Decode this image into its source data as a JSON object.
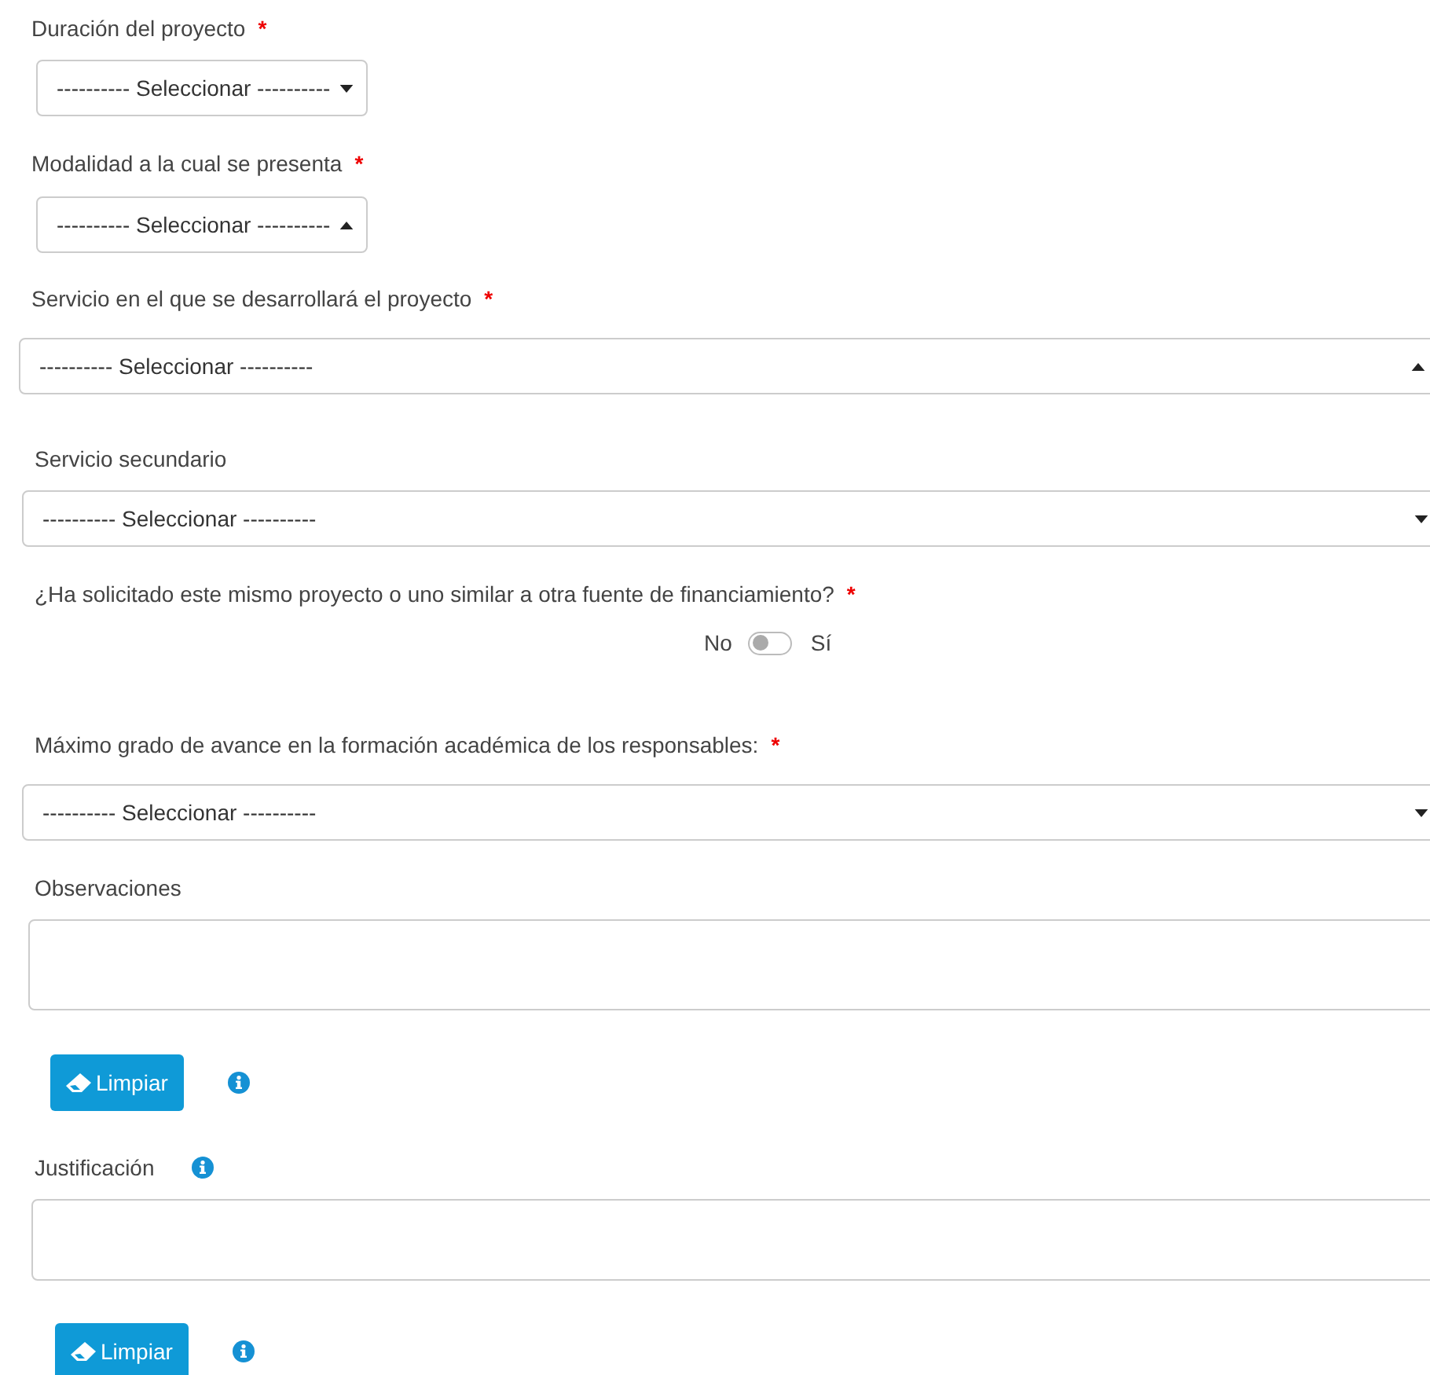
{
  "fields": [
    {
      "kind": "select",
      "label": "Duración del proyecto",
      "required_mark": "*",
      "value": "---------- Seleccionar ----------",
      "open": false
    },
    {
      "kind": "select",
      "label": "Modalidad a la cual se presenta",
      "required_mark": "*",
      "value": "---------- Seleccionar ----------",
      "open": true
    },
    {
      "kind": "select",
      "label": "Servicio en el que se desarrollará el proyecto",
      "required_mark": "*",
      "value": "---------- Seleccionar ----------",
      "open": true
    },
    {
      "kind": "select",
      "label": "Servicio secundario",
      "value": "---------- Seleccionar ----------",
      "open": false
    },
    {
      "kind": "toggle",
      "label": "¿Ha solicitado este mismo proyecto o uno similar a otra fuente de financiamiento?",
      "required_mark": "*",
      "off_label": "No",
      "on_label": "Sí",
      "on": false
    },
    {
      "kind": "select",
      "label": "Máximo grado de avance en la formación académica de los responsables:",
      "required_mark": "*",
      "value": "---------- Seleccionar ----------",
      "open": false
    },
    {
      "kind": "textarea",
      "label": "Observaciones"
    },
    {
      "kind": "actions",
      "button": "Limpiar",
      "info": true
    },
    {
      "kind": "textarea",
      "label": "Justificación",
      "info": true
    },
    {
      "kind": "actions",
      "button": "Limpiar",
      "info": true
    }
  ]
}
